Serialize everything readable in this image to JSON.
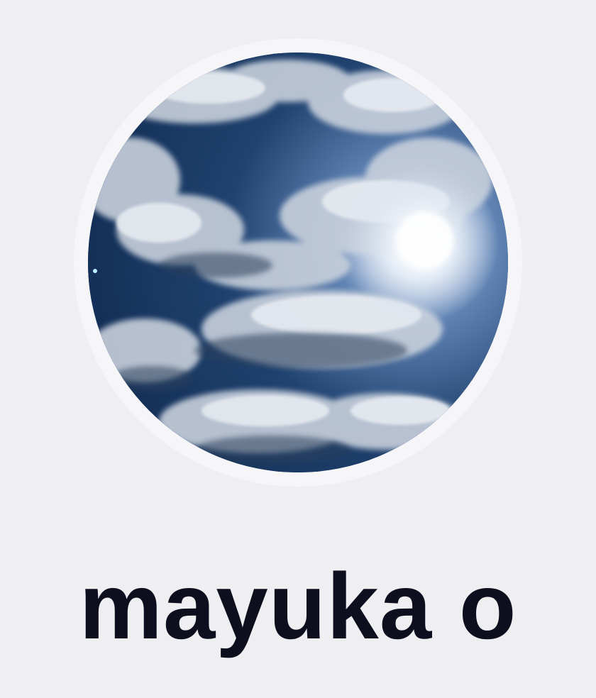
{
  "profile": {
    "display_name": "mayuka o",
    "avatar_icon": "profile-photo-sky-clouds"
  }
}
